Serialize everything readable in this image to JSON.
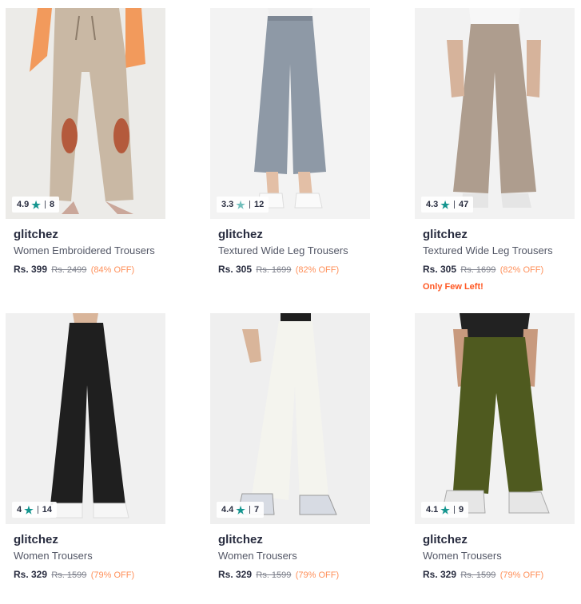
{
  "colors": {
    "star": "#14958f",
    "off": "#ff905a",
    "few_left": "#ff5722"
  },
  "products": [
    {
      "rating": "4.9",
      "count": "8",
      "brand": "glitchez",
      "name": "Women Embroidered Trousers",
      "price": "Rs. 399",
      "mrp": "Rs. 2499",
      "off": "(84% OFF)",
      "badge": ""
    },
    {
      "rating": "3.3",
      "count": "12",
      "brand": "glitchez",
      "name": "Textured Wide Leg Trousers",
      "price": "Rs. 305",
      "mrp": "Rs. 1699",
      "off": "(82% OFF)",
      "badge": ""
    },
    {
      "rating": "4.3",
      "count": "47",
      "brand": "glitchez",
      "name": "Textured Wide Leg Trousers",
      "price": "Rs. 305",
      "mrp": "Rs. 1699",
      "off": "(82% OFF)",
      "badge": "Only Few Left!"
    },
    {
      "rating": "4",
      "count": "14",
      "brand": "glitchez",
      "name": "Women Trousers",
      "price": "Rs. 329",
      "mrp": "Rs. 1599",
      "off": "(79% OFF)",
      "badge": ""
    },
    {
      "rating": "4.4",
      "count": "7",
      "brand": "glitchez",
      "name": "Women Trousers",
      "price": "Rs. 329",
      "mrp": "Rs. 1599",
      "off": "(79% OFF)",
      "badge": ""
    },
    {
      "rating": "4.1",
      "count": "9",
      "brand": "glitchez",
      "name": "Women Trousers",
      "price": "Rs. 329",
      "mrp": "Rs. 1599",
      "off": "(79% OFF)",
      "badge": ""
    }
  ]
}
